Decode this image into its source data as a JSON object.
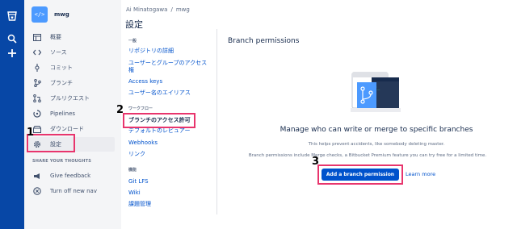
{
  "repo": {
    "name": "mwg",
    "avatar_text": "</>"
  },
  "nav": {
    "items": [
      {
        "label": "概要",
        "icon": "overview-icon"
      },
      {
        "label": "ソース",
        "icon": "source-icon"
      },
      {
        "label": "コミット",
        "icon": "commit-icon"
      },
      {
        "label": "ブランチ",
        "icon": "branch-icon"
      },
      {
        "label": "プルリクエスト",
        "icon": "pull-request-icon"
      },
      {
        "label": "Pipelines",
        "icon": "pipelines-icon"
      },
      {
        "label": "ダウンロード",
        "icon": "download-icon"
      },
      {
        "label": "設定",
        "icon": "gear-icon",
        "active": true
      }
    ],
    "section_label": "SHARE YOUR THOUGHTS",
    "feedback_label": "Give feedback",
    "turn_off_label": "Turn off new nav"
  },
  "breadcrumb": {
    "owner": "Ai Minatogawa",
    "separator": "/",
    "repo": "mwg"
  },
  "settings": {
    "title": "設定",
    "groups": [
      {
        "heading": "一般",
        "links": [
          "リポジトリの詳細",
          "ユーザーとグループのアクセス権",
          "Access keys",
          "ユーザー名のエイリアス"
        ]
      },
      {
        "heading": "ワークフロー",
        "links": [
          "ブランチのアクセス許可",
          "デフォルトのレビュアー",
          "Webhooks",
          "リンク"
        ]
      },
      {
        "heading": "機能",
        "links": [
          "Git LFS",
          "Wiki",
          "課題管理"
        ]
      }
    ]
  },
  "main": {
    "title": "Branch permissions",
    "empty_heading": "Manage who can write or merge to specific branches",
    "empty_sub1": "This helps prevent accidents, like somebody deleting master.",
    "empty_sub2": "Branch permissions include Merge checks, a Bitbucket Premium feature you can try free for a limited time.",
    "add_button": "Add a branch permission",
    "learn_more": "Learn more"
  },
  "annotations": {
    "step1": "1",
    "step2": "2",
    "step3": "3",
    "color": "#e8356d"
  },
  "colors": {
    "global_nav": "#0747a6",
    "link": "#0052cc",
    "button": "#0052cc"
  }
}
